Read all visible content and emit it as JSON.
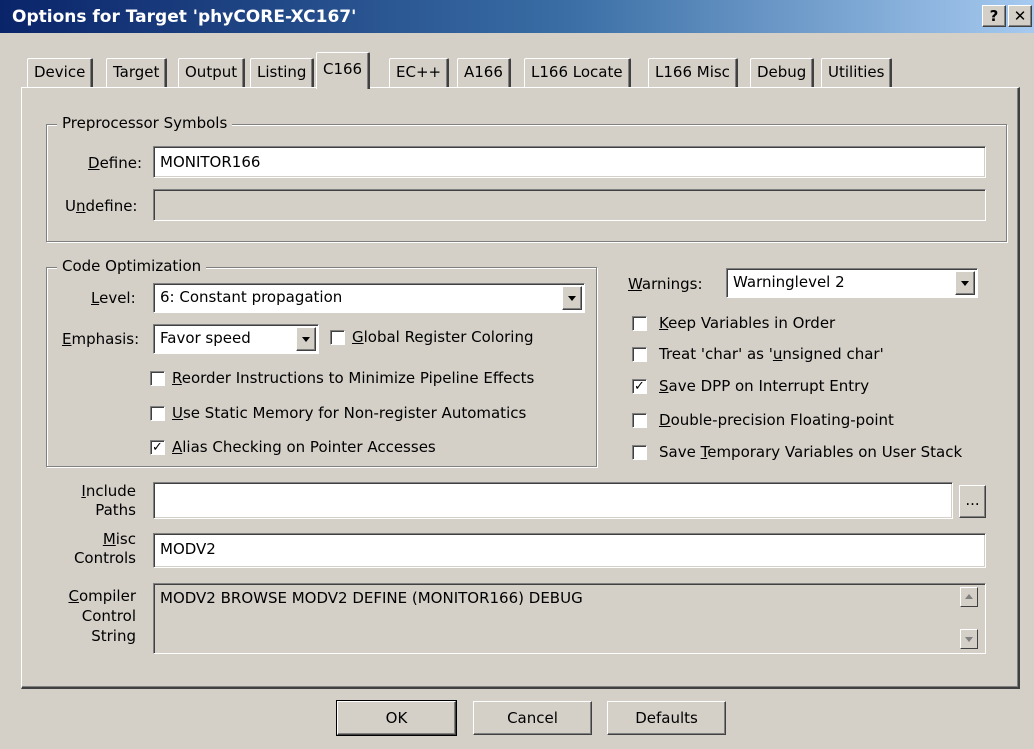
{
  "window": {
    "title": "Options for Target 'phyCORE-XC167'",
    "help_label": "?",
    "close_label": "✕"
  },
  "tabs": [
    {
      "label": "Device"
    },
    {
      "label": "Target"
    },
    {
      "label": "Output"
    },
    {
      "label": "Listing"
    },
    {
      "label": "C166",
      "active": true
    },
    {
      "label": "EC++"
    },
    {
      "label": "A166"
    },
    {
      "label": "L166 Locate"
    },
    {
      "label": "L166 Misc"
    },
    {
      "label": "Debug"
    },
    {
      "label": "Utilities"
    }
  ],
  "preprocessor": {
    "legend": "Preprocessor Symbols",
    "define_label_u": "D",
    "define_label_rest": "efine:",
    "define_value": "MONITOR166",
    "undefine_label_pre": "U",
    "undefine_label_u": "n",
    "undefine_label_rest": "define:",
    "undefine_value": ""
  },
  "code_optimization": {
    "legend": "Code Optimization",
    "level_label_u": "L",
    "level_label_rest": "evel:",
    "level_value": "6: Constant propagation",
    "emphasis_label_u": "E",
    "emphasis_label_rest": "mphasis:",
    "emphasis_value": "Favor speed",
    "global_reg_u": "G",
    "global_reg_rest": "lobal Register Coloring",
    "global_reg_checked": "",
    "reorder_u": "R",
    "reorder_rest": "eorder Instructions to Minimize Pipeline Effects",
    "reorder_checked": "",
    "static_u": "U",
    "static_rest": "se  Static Memory for Non-register Automatics",
    "static_checked": "",
    "alias_u": "A",
    "alias_rest": "lias Checking on Pointer Accesses",
    "alias_checked": "✓"
  },
  "right_options": {
    "warnings_label_u": "W",
    "warnings_label_rest": "arnings:",
    "warnings_value": "Warninglevel 2",
    "keep_vars_u": "K",
    "keep_vars_rest": "eep Variables in Order",
    "keep_vars_checked": "",
    "treat_char_pre": "Treat 'char' as '",
    "treat_char_u": "u",
    "treat_char_rest": "nsigned char'",
    "treat_char_checked": "",
    "save_dpp_u": "S",
    "save_dpp_rest": "ave DPP on Interrupt Entry",
    "save_dpp_checked": "✓",
    "double_u": "D",
    "double_rest": "ouble-precision Floating-point",
    "double_checked": "",
    "save_temp_pre": "Save ",
    "save_temp_u": "T",
    "save_temp_rest": "emporary Variables on User Stack",
    "save_temp_checked": ""
  },
  "include_paths": {
    "label_line1_u": "I",
    "label_line1_rest": "nclude",
    "label_line2": "Paths",
    "value": "",
    "browse_label": "..."
  },
  "misc_controls": {
    "label_line1_u": "M",
    "label_line1_rest": "isc",
    "label_line2": "Controls",
    "value": "MODV2"
  },
  "compiler_control": {
    "label_line1_u": "C",
    "label_line1_rest": "ompiler",
    "label_line2": "Control",
    "label_line3": "String",
    "value": "MODV2 BROWSE MODV2 DEFINE (MONITOR166) DEBUG"
  },
  "buttons": {
    "ok": "OK",
    "cancel": "Cancel",
    "defaults": "Defaults"
  }
}
